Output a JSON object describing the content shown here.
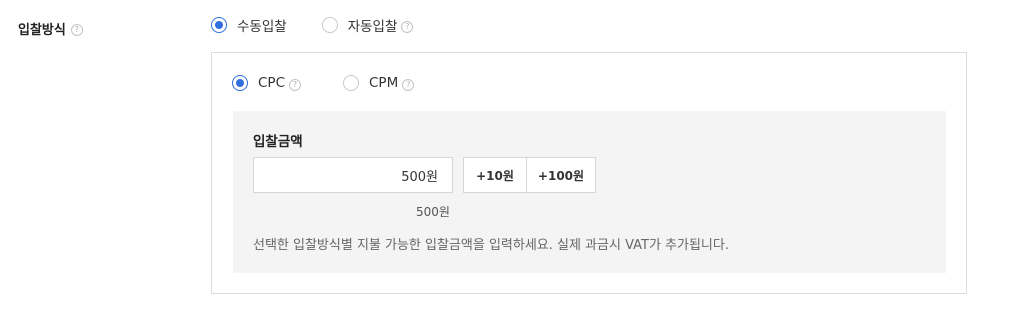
{
  "bid_method": {
    "label": "입찰방식",
    "help_glyph": "?",
    "options": [
      {
        "label": "수동입찰",
        "selected": true
      },
      {
        "label": "자동입찰",
        "selected": false
      }
    ]
  },
  "bid_type": {
    "options": [
      {
        "label": "CPC",
        "selected": true
      },
      {
        "label": "CPM",
        "selected": false
      }
    ]
  },
  "bid_amount": {
    "title": "입찰금액",
    "value": "500원",
    "increment_buttons": [
      "+10원",
      "+100원"
    ],
    "min_note": "500원",
    "helper_text": "선택한 입찰방식별 지불 가능한 입찰금액을 입력하세요. 실제 과금시 VAT가 추가됩니다."
  },
  "colors": {
    "accent": "#2f6fdf",
    "border": "#dcdcdc",
    "panel_bg": "#f4f4f4"
  },
  "icons": {
    "radio_selected": "radio-checked-icon",
    "radio_unselected": "radio-unchecked-icon",
    "help": "help-circle-icon"
  }
}
